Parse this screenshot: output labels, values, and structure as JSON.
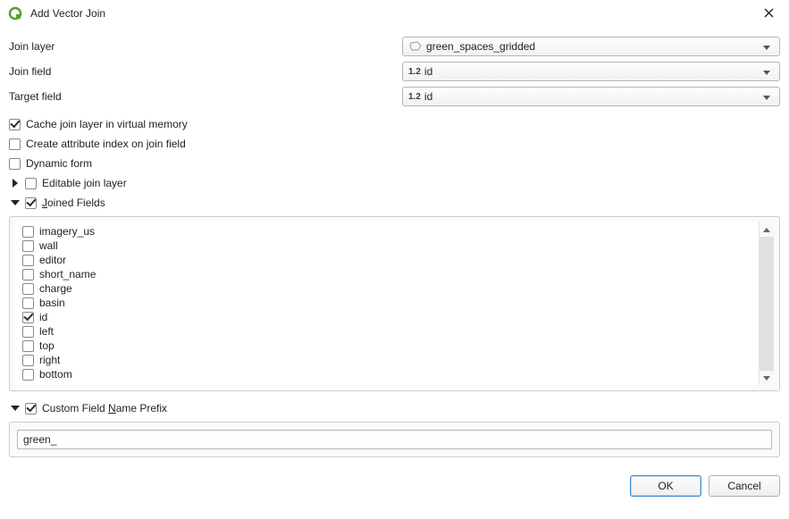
{
  "window": {
    "title": "Add Vector Join"
  },
  "form": {
    "join_layer": {
      "label": "Join layer",
      "value": "green_spaces_gridded"
    },
    "join_field": {
      "label": "Join field",
      "type_hint": "1.2",
      "value": "id"
    },
    "target_field": {
      "label": "Target field",
      "type_hint": "1.2",
      "value": "id"
    },
    "cache_label": "Cache join layer in virtual memory",
    "cache_checked": true,
    "create_index_label": "Create attribute index on join field",
    "create_index_checked": false,
    "dynamic_form_label": "Dynamic form",
    "dynamic_form_checked": false,
    "editable_label": "Editable join layer",
    "editable_checked": false,
    "joined_fields_label": "Joined Fields",
    "joined_fields_checked": true,
    "fields": [
      {
        "name": "imagery_us",
        "checked": false
      },
      {
        "name": "wall",
        "checked": false
      },
      {
        "name": "editor",
        "checked": false
      },
      {
        "name": "short_name",
        "checked": false
      },
      {
        "name": "charge",
        "checked": false
      },
      {
        "name": "basin",
        "checked": false
      },
      {
        "name": "id",
        "checked": true
      },
      {
        "name": "left",
        "checked": false
      },
      {
        "name": "top",
        "checked": false
      },
      {
        "name": "right",
        "checked": false
      },
      {
        "name": "bottom",
        "checked": false
      }
    ],
    "prefix_label": "Custom Field Name Prefix",
    "prefix_checked": true,
    "prefix_value": "green_"
  },
  "buttons": {
    "ok": "OK",
    "cancel": "Cancel"
  }
}
